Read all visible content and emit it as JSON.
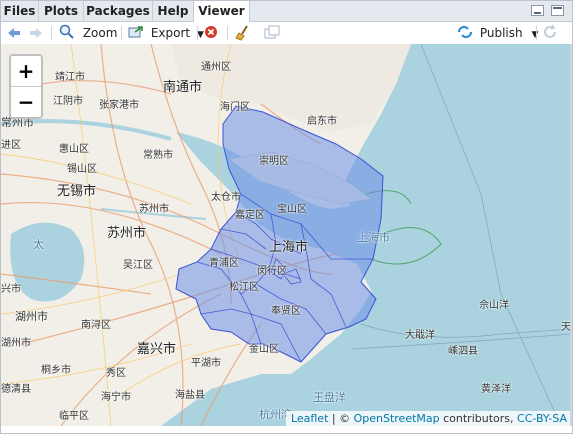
{
  "tabs": [
    {
      "label": "Files"
    },
    {
      "label": "Plots"
    },
    {
      "label": "Packages"
    },
    {
      "label": "Help"
    },
    {
      "label": "Viewer"
    }
  ],
  "toolbar": {
    "zoom_label": "Zoom",
    "export_label": "Export",
    "publish_label": "Publish"
  },
  "map": {
    "zoom_in": "+",
    "zoom_out": "−",
    "labels": {
      "nantong": "南通市",
      "tongzhou": "通州区",
      "jingjiang": "靖江市",
      "jiangyin": "江阴市",
      "zhangjiagang": "张家港市",
      "haimen": "海门区",
      "qidong": "启东市",
      "changzhou": "常州市",
      "jinqu": "进区",
      "huishan": "惠山区",
      "changshu": "常熟市",
      "wuxi": "无锡市",
      "xishan": "锡山区",
      "chongming": "崇明区",
      "taicang": "太仓市",
      "jiading": "嘉定区",
      "baoshan": "宝山区",
      "suzhou_river": "苏州市",
      "suzhou": "苏州市",
      "shanghai_big": "上海市",
      "shanghai_water": "上海市",
      "taihu": "太",
      "qingpu": "青浦区",
      "minhang": "闵行区",
      "wujiang": "吴江区",
      "songjiang": "松江区",
      "fengxian": "奉贤区",
      "xing": "兴市",
      "huzhou": "湖州市",
      "nanxun": "南浔区",
      "jiaxing": "嘉兴市",
      "pinghu": "平湖市",
      "jinshan": "金山区",
      "xiu": "秀区",
      "huzhou2": "湖州市",
      "tongxiang": "桐乡市",
      "haiyan": "海盐县",
      "haining": "海宁市",
      "deqing": "德清县",
      "linping": "临平区",
      "hangzhouwan": "杭州湾",
      "wangpanyang": "王盘洋",
      "shengsi": "嵊泗县",
      "dajiyang": "大戢洋",
      "yushan": "佘山洋",
      "huangzeyang": "黄泽洋",
      "tian": "天"
    },
    "attribution": {
      "leaflet": "Leaflet",
      "separator": " | © ",
      "osm": "OpenStreetMap",
      "contributors": " contributors, ",
      "license": "CC-BY-SA"
    },
    "colors": {
      "overlay_fill": "#6e8fe6",
      "overlay_stroke": "#3a52d4",
      "sea": "#aad3df",
      "land": "#f2efe9"
    }
  }
}
